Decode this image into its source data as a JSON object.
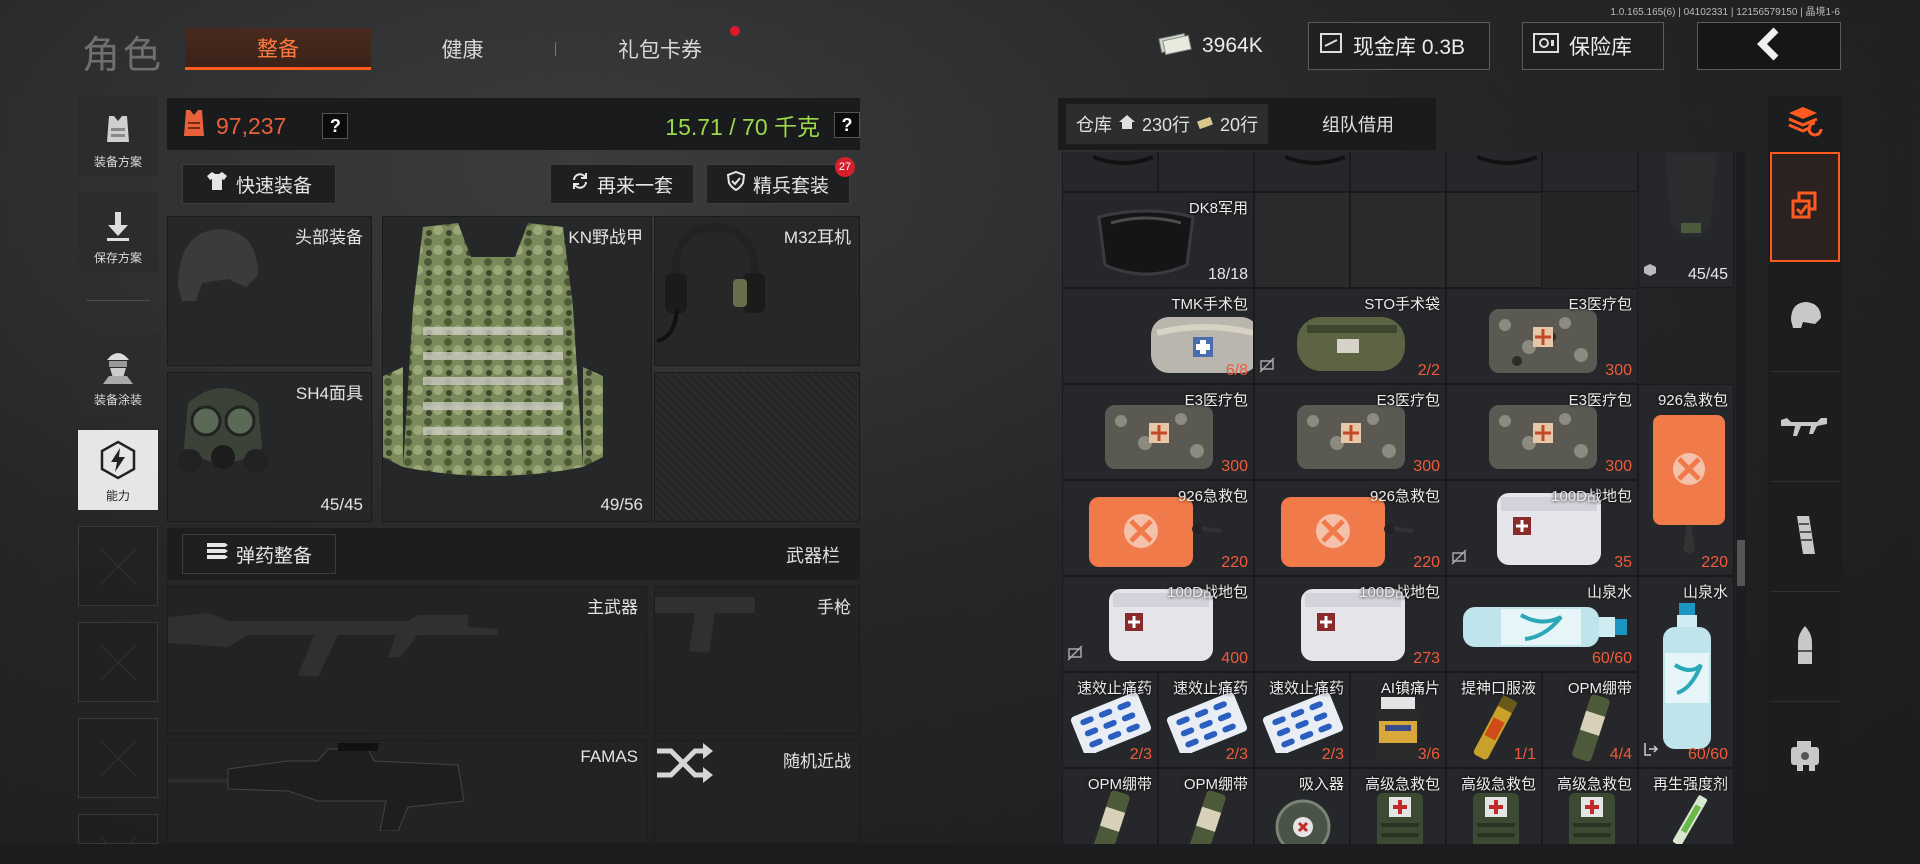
{
  "version": "1.0.165.165(6) | 04102331 | 12156579150 | 晶境1-6",
  "header": {
    "title": "角色",
    "tabs": [
      {
        "label": "整备",
        "active": true
      },
      {
        "label": "健康",
        "active": false
      },
      {
        "label": "礼包卡券",
        "active": false,
        "dot": true
      }
    ],
    "cash": "3964K",
    "cash_vault": "现金库 0.3B",
    "insurance": "保险库"
  },
  "sidebar": {
    "items": [
      {
        "label": "装备方案",
        "icon": "vest-icon"
      },
      {
        "label": "保存方案",
        "icon": "download-icon"
      },
      {
        "label": "装备涂装",
        "icon": "soldier-icon"
      },
      {
        "label": "能力",
        "icon": "ability-icon"
      }
    ]
  },
  "loadout": {
    "value": "97,237",
    "weight": "15.71 / 70 千克",
    "help": "?",
    "quick_equip": "快速装备",
    "again": "再来一套",
    "elite_set": "精兵套装",
    "elite_badge": "27",
    "slots": {
      "head": "头部装备",
      "armor": "KN野战甲",
      "armor_dur": "49/56",
      "headset": "M32耳机",
      "mask": "SH4面具",
      "mask_dur": "45/45"
    },
    "ammo_btn": "弹药整备",
    "weapon_bar": "武器栏",
    "primary": "主武器",
    "pistol": "手枪",
    "secondary": "FAMAS",
    "melee": "随机近战"
  },
  "warehouse": {
    "tab": "仓库",
    "rows": "230行",
    "rows2": "20行",
    "team": "组队借用",
    "items": [
      {
        "name": "DK8军用",
        "count": "18/18",
        "white": true
      },
      {
        "name": "",
        "count": "45/45",
        "white": true
      },
      {
        "name": "TMK手术包",
        "count": "6/8"
      },
      {
        "name": "STO手术袋",
        "count": "2/2"
      },
      {
        "name": "E3医疗包",
        "count": "300"
      },
      {
        "name": "E3医疗包",
        "count": "300"
      },
      {
        "name": "E3医疗包",
        "count": "300"
      },
      {
        "name": "E3医疗包",
        "count": "300"
      },
      {
        "name": "926急救包",
        "count": ""
      },
      {
        "name": "926急救包",
        "count": "220"
      },
      {
        "name": "926急救包",
        "count": "220"
      },
      {
        "name": "100D战地包",
        "count": "35"
      },
      {
        "name": "",
        "count": "220"
      },
      {
        "name": "100D战地包",
        "count": "400"
      },
      {
        "name": "100D战地包",
        "count": "273"
      },
      {
        "name": "山泉水",
        "count": "60/60"
      },
      {
        "name": "山泉水",
        "count": "60/60"
      },
      {
        "name": "速效止痛药",
        "count": "2/3"
      },
      {
        "name": "速效止痛药",
        "count": "2/3"
      },
      {
        "name": "速效止痛药",
        "count": "2/3"
      },
      {
        "name": "AI镇痛片",
        "count": "3/6"
      },
      {
        "name": "提神口服液",
        "count": "1/1"
      },
      {
        "name": "OPM绷带",
        "count": "4/4"
      },
      {
        "name": "OPM绷带",
        "count": ""
      },
      {
        "name": "OPM绷带",
        "count": ""
      },
      {
        "name": "吸入器",
        "count": ""
      },
      {
        "name": "高级急救包",
        "count": ""
      },
      {
        "name": "高级急救包",
        "count": ""
      },
      {
        "name": "高级急救包",
        "count": ""
      },
      {
        "name": "再生强度剂",
        "count": ""
      }
    ]
  },
  "colors": {
    "accent": "#ff5a1f",
    "value": "#e8613a",
    "weight": "#9bd84a",
    "count": "#f05a3a"
  }
}
